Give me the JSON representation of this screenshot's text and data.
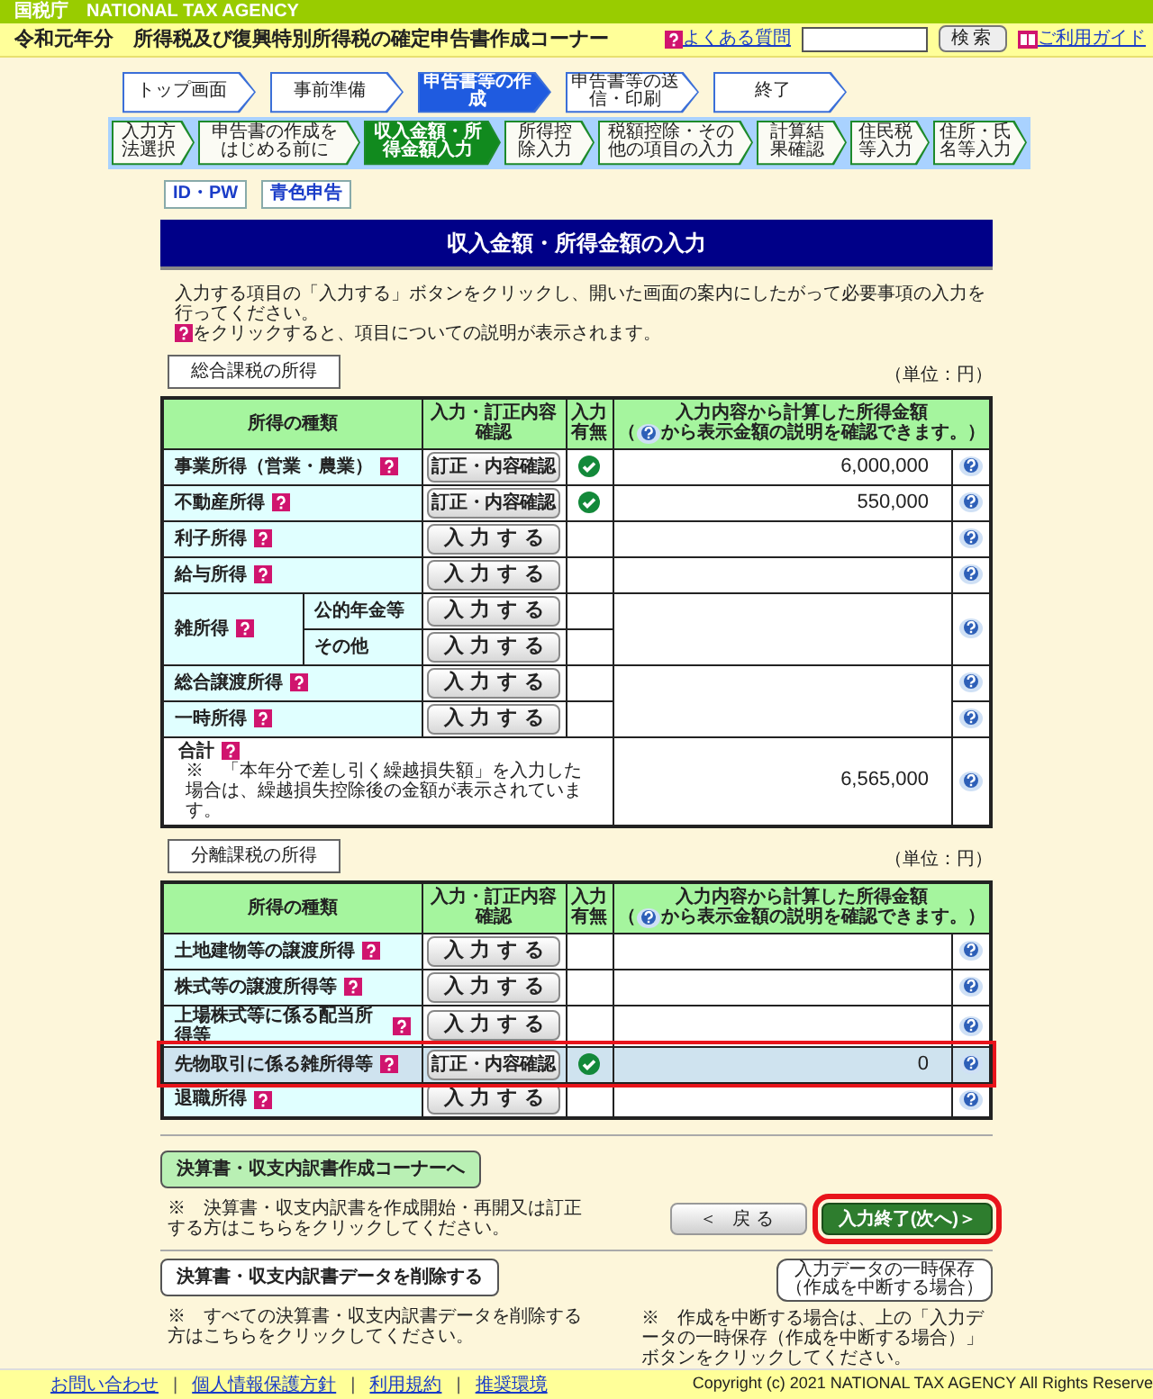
{
  "agency_bar": {
    "text": "国税庁　NATIONAL TAX AGENCY"
  },
  "header": {
    "title": "令和元年分　所得税及び復興特別所得税の確定申告書作成コーナー",
    "faq_link": "よくある質問",
    "search_button": "検索",
    "guide_link": "ご利用ガイド"
  },
  "steps": [
    {
      "label": "トップ画面",
      "selected": false
    },
    {
      "label": "事前準備",
      "selected": false
    },
    {
      "label": "申告書等の作成",
      "selected": true
    },
    {
      "label": "申告書等の送信・印刷",
      "selected": false
    },
    {
      "label": "終了",
      "selected": false
    }
  ],
  "substeps": [
    {
      "label": "入力方法選択",
      "selected": false
    },
    {
      "label": "申告書の作成をはじめる前に",
      "selected": false
    },
    {
      "label": "収入金額・所得金額入力",
      "selected": true
    },
    {
      "label": "所得控除入力",
      "selected": false
    },
    {
      "label": "税額控除・その他の項目の入力",
      "selected": false
    },
    {
      "label": "計算結果確認",
      "selected": false
    },
    {
      "label": "住民税等入力",
      "selected": false
    },
    {
      "label": "住所・氏名等入力",
      "selected": false
    }
  ],
  "mode_buttons": [
    "ID・PW",
    "青色申告"
  ],
  "page_title": "収入金額・所得金額の入力",
  "instructions": {
    "line1": "入力する項目の「入力する」ボタンをクリックし、開いた画面の案内にしたがって必要事項の入力を行ってください。",
    "line2": "をクリックすると、項目についての説明が表示されます。"
  },
  "sections": [
    {
      "label": "総合課税の所得",
      "unit": "（単位：円）",
      "columns": {
        "kind": "所得の種類",
        "action": "入力・訂正内容確認",
        "entered": "入力有無",
        "amount_line1": "入力内容から計算した所得金額",
        "amount_before_icon": "（",
        "amount_after_icon": "から表示金額の説明を確認できます。）"
      },
      "rows": [
        {
          "label": "事業所得（営業・農業）",
          "button": {
            "label": "訂正・内容確認",
            "kind": "confirm"
          },
          "entered": true,
          "amount": "6,000,000"
        },
        {
          "label": "不動産所得",
          "button": {
            "label": "訂正・内容確認",
            "kind": "confirm"
          },
          "entered": true,
          "amount": "550,000"
        },
        {
          "label": "利子所得",
          "button": {
            "label": "入力する",
            "kind": "input"
          },
          "entered": false
        },
        {
          "label": "給与所得",
          "button": {
            "label": "入力する",
            "kind": "input"
          },
          "entered": false
        },
        {
          "label": "雑所得",
          "children": [
            {
              "label": "公的年金等",
              "button": {
                "label": "入力する",
                "kind": "input"
              },
              "entered": false
            },
            {
              "label": "その他",
              "button": {
                "label": "入力する",
                "kind": "input"
              },
              "entered": false
            }
          ]
        },
        {
          "label": "総合譲渡所得",
          "button": {
            "label": "入力する",
            "kind": "input"
          },
          "entered": false,
          "amount_spans_next": true
        },
        {
          "label": "一時所得",
          "button": {
            "label": "入力する",
            "kind": "input"
          },
          "entered": false
        }
      ],
      "total": {
        "label": "合計",
        "note": "※　「本年分で差し引く繰越損失額」を入力した場合は、繰越損失控除後の金額が表示されています。",
        "amount": "6,565,000"
      }
    },
    {
      "label": "分離課税の所得",
      "unit": "（単位：円）",
      "columns": {
        "kind": "所得の種類",
        "action": "入力・訂正内容確認",
        "entered": "入力有無",
        "amount_line1": "入力内容から計算した所得金額",
        "amount_before_icon": "（",
        "amount_after_icon": "から表示金額の説明を確認できます。）"
      },
      "rows": [
        {
          "label": "土地建物等の譲渡所得",
          "button": {
            "label": "入力する",
            "kind": "input"
          },
          "entered": false,
          "highlighted": false
        },
        {
          "label": "株式等の譲渡所得等",
          "button": {
            "label": "入力する",
            "kind": "input"
          },
          "entered": false,
          "highlighted": false
        },
        {
          "label": "上場株式等に係る配当所得等",
          "button": {
            "label": "入力する",
            "kind": "input"
          },
          "entered": false,
          "highlighted": false
        },
        {
          "label": "先物取引に係る雑所得等",
          "button": {
            "label": "訂正・内容確認",
            "kind": "confirm"
          },
          "entered": true,
          "amount": "0",
          "highlighted": true
        },
        {
          "label": "退職所得",
          "button": {
            "label": "入力する",
            "kind": "input"
          },
          "entered": false,
          "highlighted": false
        }
      ]
    }
  ],
  "bottom": {
    "report_button": "決算書・収支内訳書作成コーナーへ",
    "report_note": "※　決算書・収支内訳書を作成開始・再開又は訂正する方はこちらをクリックしてください。",
    "back_button": "＜ 戻る",
    "next_button": {
      "label": "入力終了(次へ)＞",
      "highlighted": true
    },
    "delete_button": "決算書・収支内訳書データを削除する",
    "delete_note": "※　すべての決算書・収支内訳書データを削除する方はこちらをクリックしてください。",
    "save_button_line1": "入力データの一時保存",
    "save_button_line2": "（作成を中断する場合）",
    "save_note": "※　作成を中断する場合は、上の「入力データの一時保存（作成を中断する場合）」ボタンをクリックしてください。"
  },
  "footer": {
    "links": [
      "お問い合わせ",
      "個人情報保護方針",
      "利用規約",
      "推奨環境"
    ],
    "separator": "|",
    "copyright": "Copyright (c) 2021 NATIONAL TAX AGENCY All Rights Reserve"
  }
}
